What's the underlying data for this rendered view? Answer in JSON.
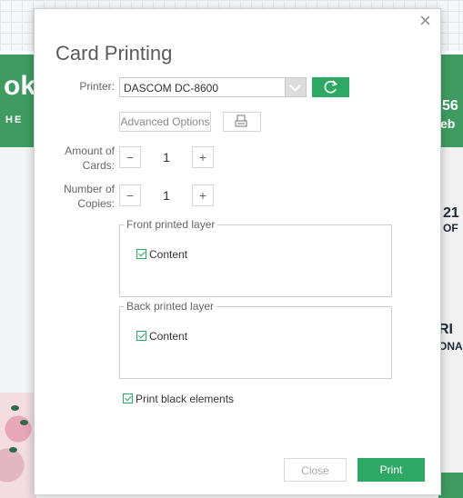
{
  "background": {
    "left_band_text": "ok",
    "left_band_sub": "HE",
    "right_band_text": "56",
    "right_band_sub": "eb",
    "right_mid_1": "21",
    "right_mid_1_sub": "OF",
    "right_mid_2": "RI",
    "right_mid_2_sub": "ONA"
  },
  "dialog": {
    "title": "Card Printing",
    "close_icon": "×",
    "printer_label": "Printer:",
    "printer_value": "DASCOM DC-8600",
    "advanced_options_label": "Advanced Options",
    "amount_label_1": "Amount of",
    "amount_label_2": "Cards:",
    "amount_value": "1",
    "copies_label_1": "Number of",
    "copies_label_2": "Copies:",
    "copies_value": "1",
    "minus": "−",
    "plus": "+",
    "front_layer_legend": "Front printed layer",
    "front_content_label": "Content",
    "back_layer_legend": "Back printed layer",
    "back_content_label": "Content",
    "print_black_label": "Print black elements",
    "close_button": "Close",
    "print_button": "Print"
  },
  "colors": {
    "accent": "#2ea865",
    "band": "#3e9c61"
  },
  "icons": [
    "close-icon",
    "chevron-down-icon",
    "refresh-icon",
    "printer-icon",
    "checkbox-checked-icon"
  ]
}
